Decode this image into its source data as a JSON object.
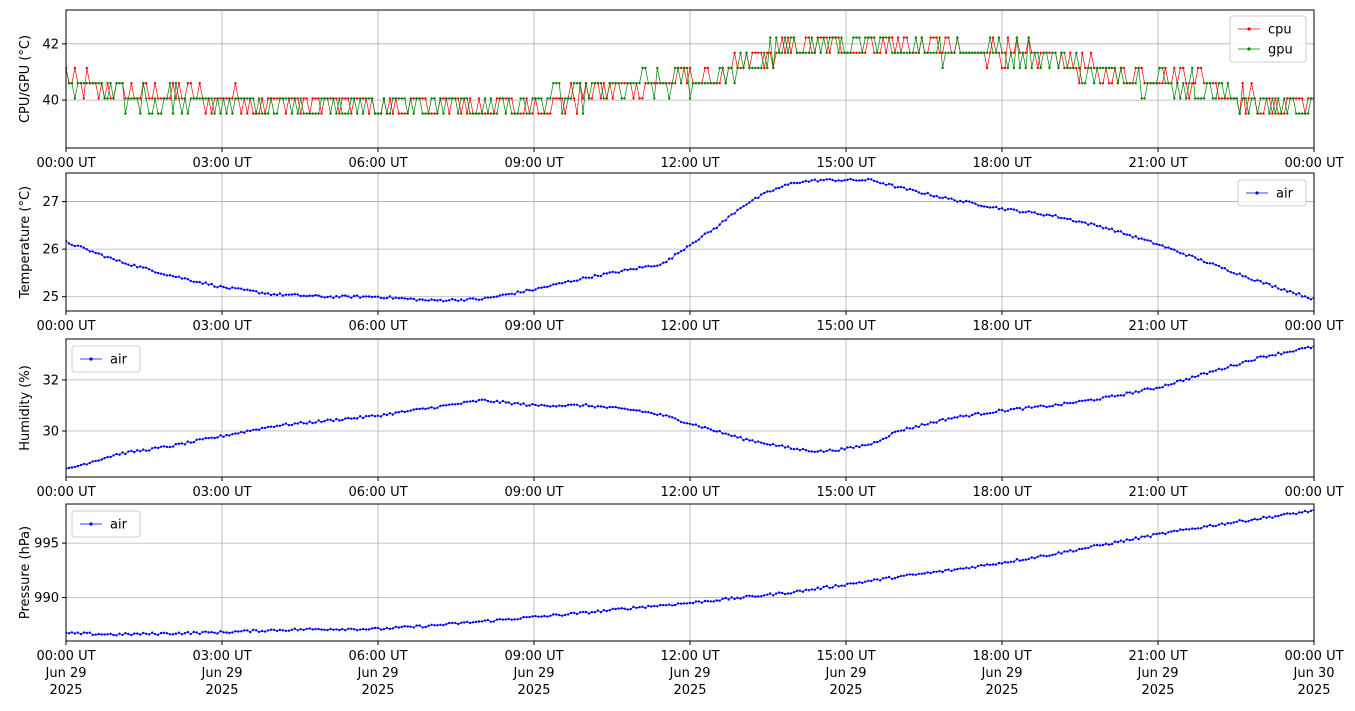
{
  "figure": {
    "x_tick_labels": [
      "00:00 UT",
      "03:00 UT",
      "06:00 UT",
      "09:00 UT",
      "12:00 UT",
      "15:00 UT",
      "18:00 UT",
      "21:00 UT",
      "00:00 UT"
    ],
    "x_date_lines": [
      "Jun 29",
      "Jun 29",
      "Jun 29",
      "Jun 29",
      "Jun 29",
      "Jun 29",
      "Jun 29",
      "Jun 29",
      "Jun 30"
    ],
    "x_year_lines": [
      "2025",
      "2025",
      "2025",
      "2025",
      "2025",
      "2025",
      "2025",
      "2025",
      "2025"
    ]
  },
  "chart_data": [
    {
      "type": "line",
      "ylabel": "CPU/GPU (°C)",
      "ylim": [
        38.3,
        43.2
      ],
      "yticks": [
        "40",
        "42"
      ],
      "ytick_values": [
        40,
        42
      ],
      "grid": true,
      "legend_placement": "top-right",
      "x_range_hours": [
        0,
        24
      ],
      "series": [
        {
          "name": "cpu",
          "color": "#ff0000",
          "x_hours": [
            0,
            0.5,
            1,
            2,
            3,
            4,
            5,
            6,
            7,
            8,
            9,
            10,
            11,
            12,
            12.5,
            13,
            13.5,
            14,
            15,
            16,
            17,
            18,
            19,
            19.5,
            20,
            21,
            22,
            22.5,
            23,
            24
          ],
          "values": [
            40.7,
            40.4,
            40.1,
            40.1,
            40.0,
            39.8,
            39.8,
            39.7,
            39.6,
            39.7,
            39.7,
            40.1,
            40.5,
            40.7,
            40.7,
            41.1,
            41.4,
            41.7,
            41.8,
            41.8,
            41.7,
            41.6,
            41.4,
            41.1,
            40.8,
            40.7,
            40.6,
            40.1,
            39.8,
            39.7
          ]
        },
        {
          "name": "gpu",
          "color": "#008000",
          "x_hours": [
            0,
            0.5,
            1,
            2,
            3,
            4,
            5,
            6,
            7,
            8,
            9,
            10,
            11,
            12,
            12.5,
            13,
            13.5,
            14,
            15,
            16,
            17,
            18,
            19,
            19.5,
            20,
            21,
            22,
            22.5,
            23,
            24
          ],
          "values": [
            40.6,
            40.4,
            40.0,
            39.9,
            39.8,
            39.8,
            39.7,
            39.7,
            39.6,
            39.7,
            39.8,
            40.1,
            40.4,
            40.6,
            40.8,
            41.0,
            41.5,
            41.7,
            41.8,
            41.8,
            41.7,
            41.6,
            41.5,
            41.0,
            40.8,
            40.6,
            40.3,
            40.0,
            39.8,
            39.7
          ]
        }
      ]
    },
    {
      "type": "line",
      "ylabel": "Temperature (°C)",
      "ylim": [
        24.7,
        27.6
      ],
      "yticks": [
        "25",
        "26",
        "27"
      ],
      "ytick_values": [
        25,
        26,
        27
      ],
      "grid": true,
      "legend_placement": "top-right",
      "x_range_hours": [
        0,
        24
      ],
      "series": [
        {
          "name": "air",
          "color": "#0000ff",
          "x_hours": [
            0,
            0.5,
            1,
            2,
            3,
            4,
            5,
            6,
            7,
            8,
            9,
            10,
            11,
            11.5,
            12,
            12.5,
            13,
            13.5,
            14,
            14.5,
            15,
            15.5,
            16,
            17,
            18,
            19,
            20,
            21,
            22,
            23,
            24
          ],
          "values": [
            26.15,
            25.95,
            25.75,
            25.45,
            25.2,
            25.05,
            25.0,
            25.0,
            24.92,
            24.95,
            25.15,
            25.4,
            25.6,
            25.7,
            26.1,
            26.45,
            26.9,
            27.2,
            27.4,
            27.45,
            27.45,
            27.45,
            27.3,
            27.05,
            26.85,
            26.7,
            26.45,
            26.1,
            25.7,
            25.3,
            24.95
          ]
        }
      ]
    },
    {
      "type": "line",
      "ylabel": "Humidity (%)",
      "ylim": [
        28.2,
        33.6
      ],
      "yticks": [
        "30",
        "32"
      ],
      "ytick_values": [
        30,
        32
      ],
      "grid": true,
      "legend_placement": "top-left",
      "x_range_hours": [
        0,
        24
      ],
      "series": [
        {
          "name": "air",
          "color": "#0000ff",
          "x_hours": [
            0,
            0.5,
            1,
            2,
            3,
            4,
            5,
            6,
            7,
            8,
            9,
            10,
            11,
            11.5,
            12,
            12.5,
            13,
            13.5,
            14,
            14.5,
            15,
            15.5,
            16,
            17,
            18,
            19,
            20,
            21,
            22,
            23,
            24
          ],
          "values": [
            28.5,
            28.8,
            29.1,
            29.4,
            29.8,
            30.2,
            30.4,
            30.6,
            30.9,
            31.2,
            31.0,
            31.0,
            30.8,
            30.6,
            30.3,
            30.0,
            29.7,
            29.5,
            29.3,
            29.2,
            29.3,
            29.5,
            30.0,
            30.5,
            30.8,
            31.0,
            31.3,
            31.7,
            32.3,
            32.9,
            33.3
          ]
        }
      ]
    },
    {
      "type": "line",
      "ylabel": "Pressure (hPa)",
      "ylim": [
        986.0,
        998.6
      ],
      "yticks": [
        "990",
        "995"
      ],
      "ytick_values": [
        990,
        995
      ],
      "grid": true,
      "legend_placement": "top-left",
      "x_range_hours": [
        0,
        24
      ],
      "series": [
        {
          "name": "air",
          "color": "#0000ff",
          "x_hours": [
            0,
            1,
            2,
            3,
            4,
            5,
            6,
            7,
            8,
            9,
            10,
            11,
            12,
            13,
            14,
            15,
            16,
            17,
            18,
            19,
            20,
            21,
            22,
            23,
            24
          ],
          "values": [
            986.7,
            986.6,
            986.7,
            986.8,
            987.0,
            987.1,
            987.1,
            987.4,
            987.8,
            988.2,
            988.6,
            989.1,
            989.5,
            990.0,
            990.5,
            991.2,
            991.9,
            992.5,
            993.2,
            994.0,
            994.9,
            995.8,
            996.6,
            997.3,
            998.0
          ]
        }
      ]
    }
  ]
}
